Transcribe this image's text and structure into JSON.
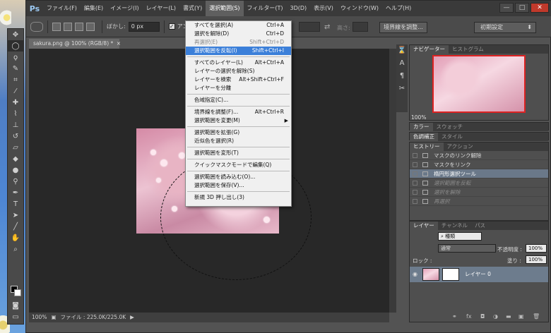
{
  "app": {
    "logo": "Ps"
  },
  "menubar": {
    "items": [
      "ファイル(F)",
      "編集(E)",
      "イメージ(I)",
      "レイヤー(L)",
      "書式(Y)",
      "選択範囲(S)",
      "フィルター(T)",
      "3D(D)",
      "表示(V)",
      "ウィンドウ(W)",
      "ヘルプ(H)"
    ],
    "active_index": 5
  },
  "window_controls": {
    "minimize": "—",
    "maximize": "□",
    "close": "✕"
  },
  "options_bar": {
    "feather_label": "ぼかし:",
    "feather_value": "0 px",
    "antialias_label": "アンチ",
    "height_label": "高さ:",
    "refine_edge_button": "境界線を調整...",
    "workspace_select": "初期設定"
  },
  "document": {
    "tab_title": "sakura.png @ 100% (RGB/8) *",
    "close": "×"
  },
  "status_bar": {
    "zoom": "100%",
    "file_info": "ファイル : 225.0K/225.0K",
    "arrow": "▶"
  },
  "select_menu": {
    "items": [
      {
        "label": "すべてを選択(A)",
        "shortcut": "Ctrl+A",
        "disabled": false,
        "highlighted": false
      },
      {
        "label": "選択を解除(D)",
        "shortcut": "Ctrl+D",
        "disabled": false,
        "highlighted": false
      },
      {
        "label": "再選択(E)",
        "shortcut": "Shift+Ctrl+D",
        "disabled": true,
        "highlighted": false
      },
      {
        "label": "選択範囲を反転(I)",
        "shortcut": "Shift+Ctrl+I",
        "disabled": false,
        "highlighted": true
      },
      {
        "separator": true
      },
      {
        "label": "すべてのレイヤー(L)",
        "shortcut": "Alt+Ctrl+A",
        "disabled": false,
        "highlighted": false
      },
      {
        "label": "レイヤーの選択を解除(S)",
        "shortcut": "",
        "disabled": false,
        "highlighted": false
      },
      {
        "label": "レイヤーを検索",
        "shortcut": "Alt+Shift+Ctrl+F",
        "disabled": false,
        "highlighted": false
      },
      {
        "label": "レイヤーを分離",
        "shortcut": "",
        "disabled": false,
        "highlighted": false
      },
      {
        "separator": true
      },
      {
        "label": "色域指定(C)...",
        "shortcut": "",
        "disabled": false,
        "highlighted": false
      },
      {
        "separator": true
      },
      {
        "label": "境界線を調整(F)...",
        "shortcut": "Alt+Ctrl+R",
        "disabled": false,
        "highlighted": false
      },
      {
        "label": "選択範囲を変更(M)",
        "shortcut": "",
        "submenu": true,
        "disabled": false,
        "highlighted": false
      },
      {
        "separator": true
      },
      {
        "label": "選択範囲を拡張(G)",
        "shortcut": "",
        "disabled": false,
        "highlighted": false
      },
      {
        "label": "近似色を選択(R)",
        "shortcut": "",
        "disabled": false,
        "highlighted": false
      },
      {
        "separator": true
      },
      {
        "label": "選択範囲を変形(T)",
        "shortcut": "",
        "disabled": false,
        "highlighted": false
      },
      {
        "separator": true
      },
      {
        "label": "クイックマスクモードで編集(Q)",
        "shortcut": "",
        "disabled": false,
        "highlighted": false
      },
      {
        "separator": true
      },
      {
        "label": "選択範囲を読み込む(O)...",
        "shortcut": "",
        "disabled": false,
        "highlighted": false
      },
      {
        "label": "選択範囲を保存(V)...",
        "shortcut": "",
        "disabled": false,
        "highlighted": false
      },
      {
        "separator": true
      },
      {
        "label": "新規 3D 押し出し(3)",
        "shortcut": "",
        "disabled": false,
        "highlighted": false
      }
    ]
  },
  "navigator_panel": {
    "tabs": [
      "ナビゲーター",
      "ヒストグラム"
    ],
    "zoom": "100%"
  },
  "color_panel": {
    "tabs": [
      "カラー",
      "スウォッチ"
    ]
  },
  "adjust_panel": {
    "tabs": [
      "色調補正",
      "スタイル"
    ]
  },
  "history_panel": {
    "tabs": [
      "ヒストリー",
      "アクション"
    ],
    "items": [
      {
        "label": "マスクのリンク解除",
        "state": "normal"
      },
      {
        "label": "マスクをリンク",
        "state": "normal"
      },
      {
        "label": "楕円形選択ツール",
        "state": "selected"
      },
      {
        "label": "選択範囲を反転",
        "state": "undone"
      },
      {
        "label": "選択を解除",
        "state": "undone"
      },
      {
        "label": "再選択",
        "state": "undone"
      }
    ]
  },
  "layers_panel": {
    "tabs": [
      "レイヤー",
      "チャンネル",
      "パス"
    ],
    "filter_label": "種類",
    "blend_mode": "通常",
    "opacity_label": "不透明度 :",
    "opacity_value": "100%",
    "lock_label": "ロック :",
    "fill_label": "塗り :",
    "fill_value": "100%",
    "layer_name": "レイヤー 0"
  }
}
